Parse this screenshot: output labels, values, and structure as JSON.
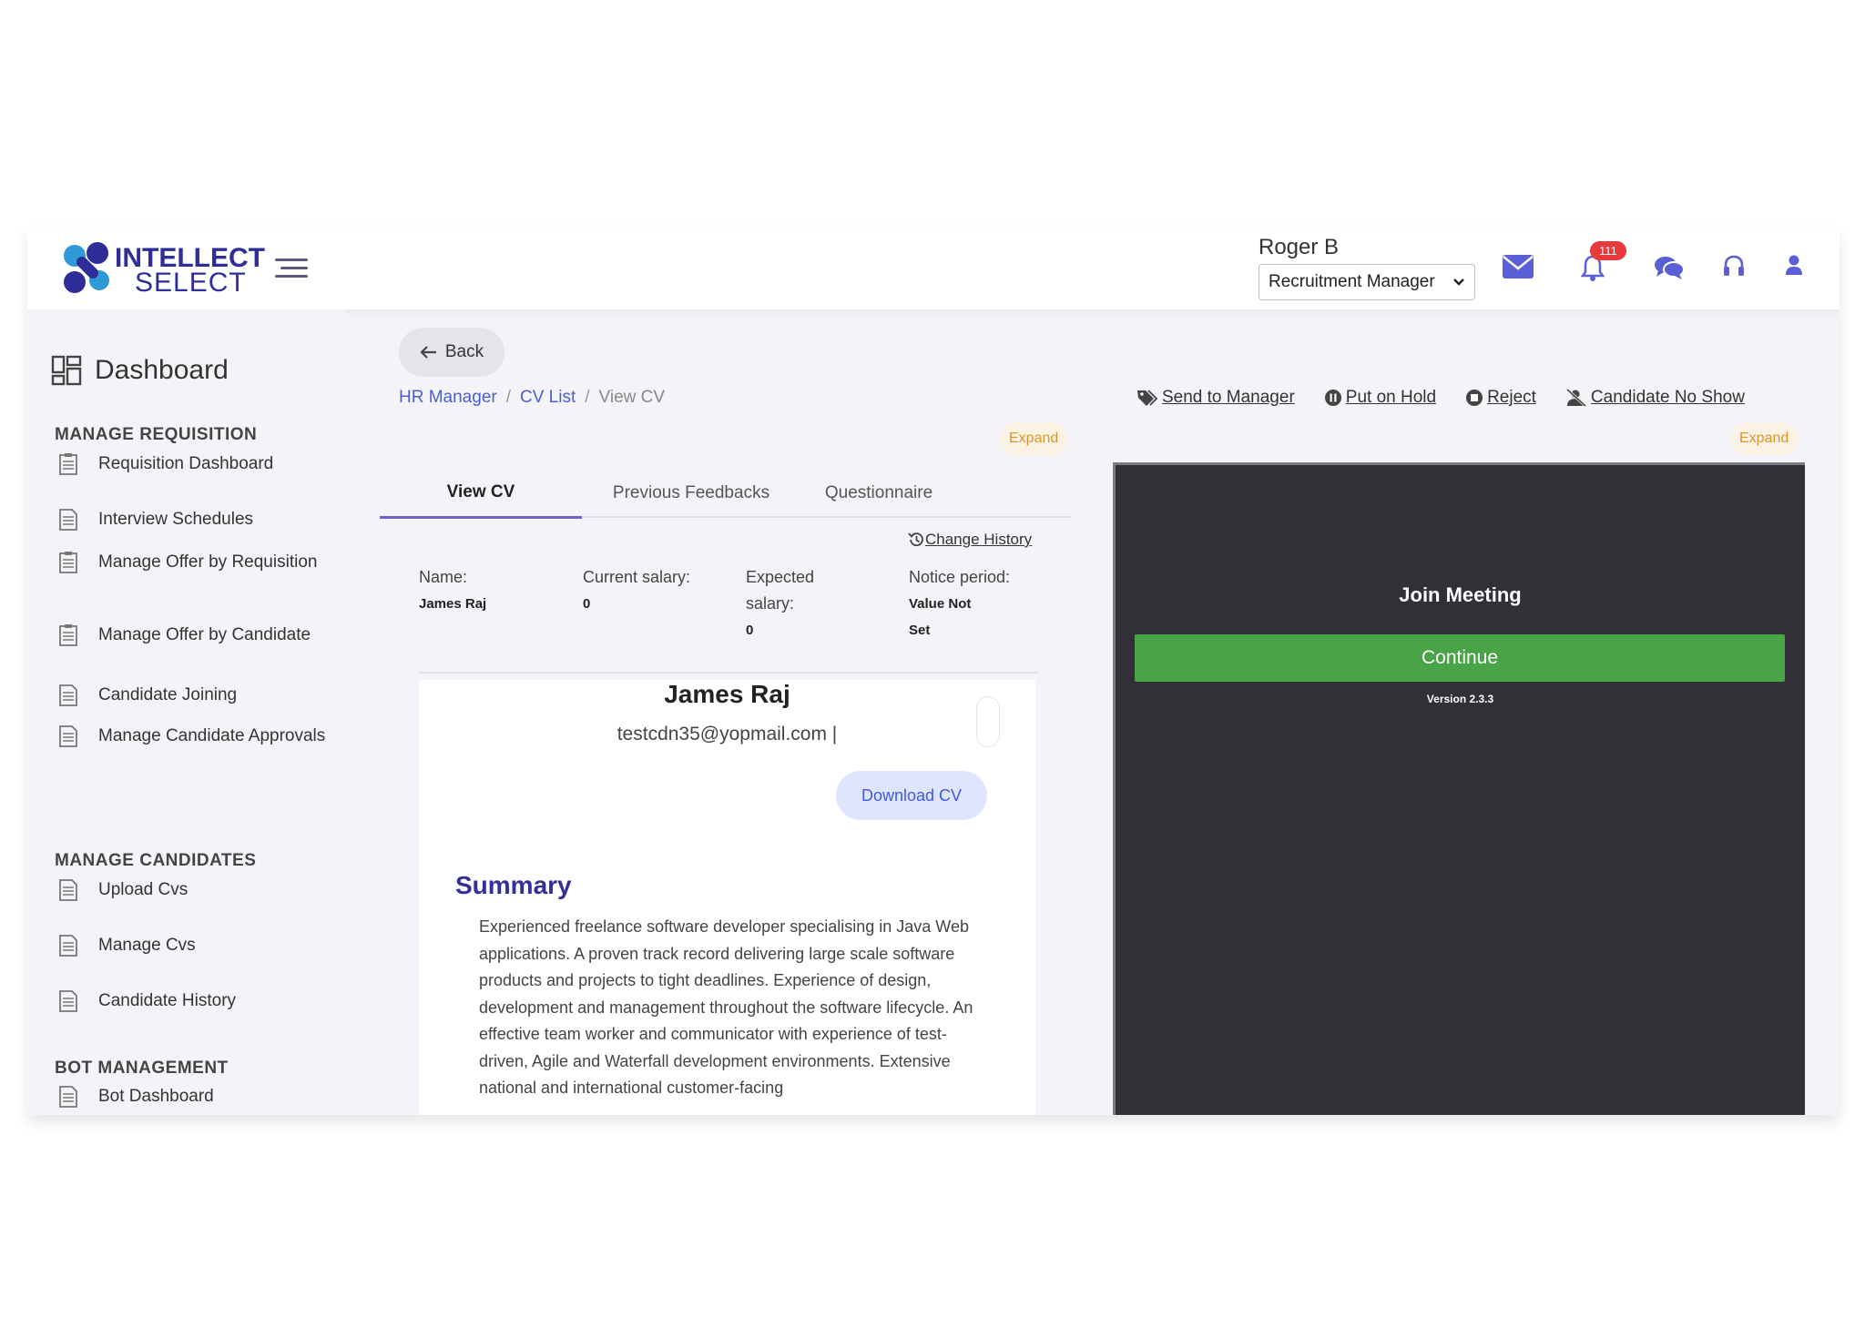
{
  "header": {
    "logo_line1": "INTELLECT",
    "logo_line2": "SELECT",
    "user_name": "Roger B",
    "role": "Recruitment Manager",
    "notifications_count": "111"
  },
  "sidebar": {
    "dashboard_label": "Dashboard",
    "sections": [
      {
        "title": "MANAGE REQUISITION",
        "items": [
          "Requisition Dashboard",
          "Interview Schedules",
          "Manage Offer by Requisition",
          "Manage Offer by Candidate",
          "Candidate Joining",
          "Manage Candidate Approvals"
        ]
      },
      {
        "title": "MANAGE CANDIDATES",
        "items": [
          "Upload Cvs",
          "Manage Cvs",
          "Candidate History"
        ]
      },
      {
        "title": "BOT MANAGEMENT",
        "items": [
          "Bot Dashboard"
        ]
      }
    ]
  },
  "main": {
    "back_label": "Back",
    "breadcrumb": [
      "HR Manager",
      "CV List",
      "View CV"
    ],
    "actions": [
      "Send to Manager",
      "Put on Hold",
      "Reject",
      "Candidate No Show"
    ],
    "expand_label": "Expand",
    "tabs": [
      "View CV",
      "Previous Feedbacks",
      "Questionnaire"
    ],
    "change_history_label": "Change History",
    "info": {
      "name_label": "Name:",
      "name_value": "James Raj",
      "current_salary_label": "Current salary:",
      "current_salary_value": "0",
      "expected_salary_label": "Expected salary:",
      "expected_salary_value": "0",
      "notice_label": "Notice period:",
      "notice_value": "Value Not Set"
    },
    "cv": {
      "name": "James Raj",
      "email": "testcdn35@yopmail.com |",
      "download_label": "Download CV",
      "summary_title": "Summary",
      "summary_text": "Experienced freelance software developer specialising in Java Web applications. A proven track record delivering large scale software products and projects to tight deadlines. Experience of design, development and management throughout the software lifecycle. An effective team worker and communicator with experience of test-driven, Agile and Waterfall development environments. Extensive national and international customer-facing"
    }
  },
  "meeting": {
    "title": "Join Meeting",
    "continue_label": "Continue",
    "version": "Version 2.3.3"
  },
  "colors": {
    "brand": "#2f2d9a",
    "accent_blue": "#4a5fd0",
    "continue_green": "#48a446",
    "meeting_bg": "#322f37",
    "expand_text": "#d9952a",
    "badge_red": "#e83a3a"
  }
}
